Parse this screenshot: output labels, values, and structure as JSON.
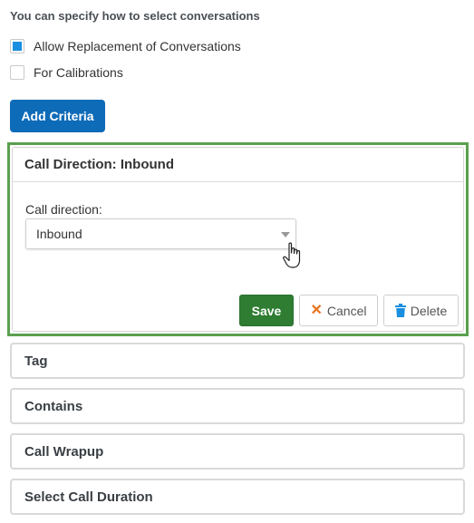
{
  "heading": "You can specify how to select conversations",
  "options": [
    {
      "label": "Allow Replacement of Conversations",
      "checked": true
    },
    {
      "label": "For Calibrations",
      "checked": false
    }
  ],
  "add_criteria_label": "Add Criteria",
  "active_panel": {
    "title": "Call Direction: Inbound",
    "field_label": "Call direction:",
    "select_value": "Inbound",
    "save_label": "Save",
    "cancel_label": "Cancel",
    "delete_label": "Delete"
  },
  "collapsed_panels": [
    "Tag",
    "Contains",
    "Call Wrapup",
    "Select Call Duration"
  ],
  "colors": {
    "primary": "#0e6bb8",
    "save": "#2e7d32",
    "highlight": "#5aa04e",
    "checkbox": "#1a8fe0",
    "cancel_icon": "#e8731c",
    "delete_icon": "#1a8fe0"
  }
}
